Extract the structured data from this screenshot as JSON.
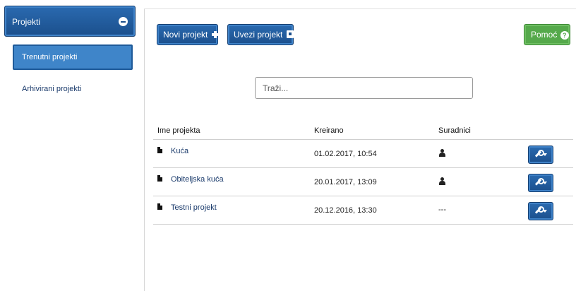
{
  "sidebar": {
    "header_label": "Projekti",
    "items": [
      {
        "label": "Trenutni projekti",
        "active": true
      },
      {
        "label": "Arhivirani projekti",
        "active": false
      }
    ]
  },
  "toolbar": {
    "new_project_label": "Novi projekt",
    "import_project_label": "Uvezi projekt",
    "help_label": "Pomoć",
    "help_icon_glyph": "?"
  },
  "search": {
    "placeholder": "Traži..."
  },
  "table": {
    "headers": [
      "Ime projekta",
      "Kreirano",
      "Suradnici"
    ],
    "rows": [
      {
        "name": "Kuća",
        "created": "01.02.2017, 10:54",
        "collaborators": "user-icon"
      },
      {
        "name": "Obiteljska kuća",
        "created": "20.01.2017, 13:09",
        "collaborators": "user-icon"
      },
      {
        "name": "Testni projekt",
        "created": "20.12.2016, 13:30",
        "collaborators_text": "---"
      }
    ]
  },
  "colors": {
    "primary_blue": "#1b4f8c",
    "active_blue": "#3f85c9",
    "help_green": "#55a94b",
    "link_color": "#1a3a6b"
  },
  "icons": {
    "sidebar_collapse": "minus-circle-icon",
    "new_project": "plus-icon",
    "import_project": "import-icon",
    "help": "question-circle-icon",
    "row_file": "file-icon",
    "row_tools": "wrench-icon"
  }
}
